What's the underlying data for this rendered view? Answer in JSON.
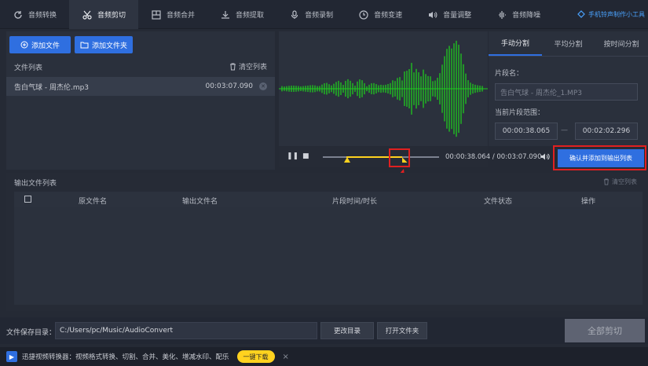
{
  "tabs": [
    {
      "label": "音频转换",
      "icon": "refresh-icon"
    },
    {
      "label": "音频剪切",
      "icon": "scissors-icon",
      "active": true
    },
    {
      "label": "音频合并",
      "icon": "merge-icon"
    },
    {
      "label": "音频提取",
      "icon": "extract-icon"
    },
    {
      "label": "音频录制",
      "icon": "microphone-icon"
    },
    {
      "label": "音频变速",
      "icon": "speed-icon"
    },
    {
      "label": "音量调整",
      "icon": "volume-adjust-icon"
    },
    {
      "label": "音频降噪",
      "icon": "denoise-icon"
    }
  ],
  "helper_link": "手机铃声制作小工具",
  "left": {
    "add_file": "添加文件",
    "add_folder": "添加文件夹",
    "file_list_title": "文件列表",
    "clear_list": "清空列表",
    "files": [
      {
        "name": "告白气球 - 周杰伦.mp3",
        "duration": "00:03:07.090"
      }
    ]
  },
  "player": {
    "current_time": "00:00:38.064",
    "separator": "/",
    "total_time": "00:03:07.090",
    "progress_fraction": 0.2,
    "selection_start_fraction": 0.2,
    "selection_end_fraction": 0.68
  },
  "split": {
    "tabs": [
      "手动分割",
      "平均分割",
      "按时间分割"
    ],
    "segment_name_label": "片段名：",
    "segment_name_placeholder": "告白气球 - 周杰伦_1.MP3",
    "range_label": "当前片段范围：",
    "range_start": "00:00:38.065",
    "range_dash": "—",
    "range_end": "00:02:02.296",
    "confirm_button": "确认并添加到输出列表"
  },
  "output": {
    "title": "输出文件列表",
    "clear": "清空列表",
    "columns": [
      "原文件名",
      "输出文件名",
      "片段时间/时长",
      "文件状态",
      "操作"
    ]
  },
  "savebar": {
    "label": "文件保存目录：",
    "path": "C:/Users/pc/Music/AudioConvert",
    "change_dir": "更改目录",
    "open_folder": "打开文件夹",
    "cut_all": "全部剪切"
  },
  "adbar": {
    "text": "迅捷视频转换器：视频格式转换、切割、合并、美化、增减水印、配乐",
    "download": "一键下载",
    "close": "×"
  },
  "colors": {
    "accent": "#2f6fe0",
    "wave": "#1fc91f",
    "highlight": "#ffd21f",
    "annotation": "#e02020"
  }
}
